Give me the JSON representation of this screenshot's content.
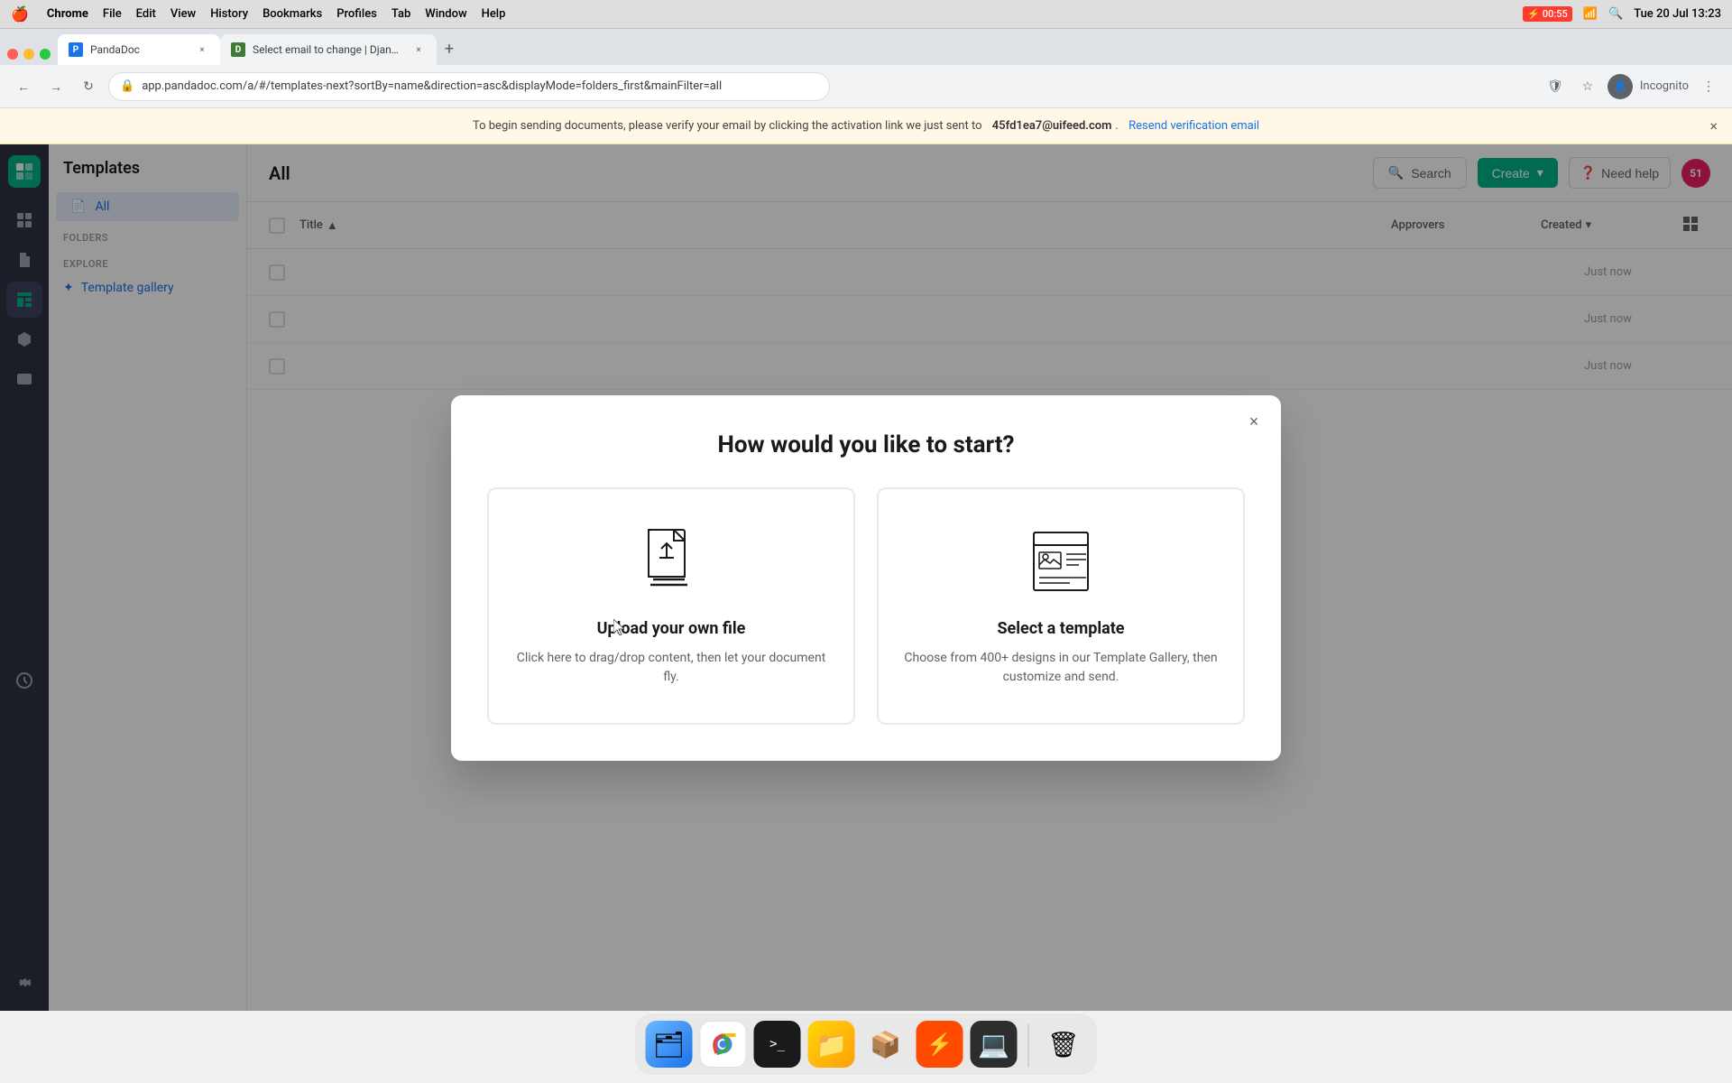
{
  "menubar": {
    "apple": "🍎",
    "app_name": "Chrome",
    "items": [
      "File",
      "Edit",
      "View",
      "History",
      "Bookmarks",
      "Profiles",
      "Tab",
      "Window",
      "Help"
    ],
    "battery_label": "00:55",
    "time": "Tue 20 Jul  13:23"
  },
  "browser": {
    "tab1_title": "PandaDoc",
    "tab2_title": "Select email to change | Djang...",
    "url": "app.pandadoc.com/a/#/templates-next?sortBy=name&direction=asc&displayMode=folders_first&mainFilter=all"
  },
  "notification": {
    "text": "To begin sending documents, please verify your email by clicking the activation link we just sent to",
    "email": "45fd1ea7@uifeed.com",
    "link_text": "Resend verification email"
  },
  "sidebar": {
    "items": [
      {
        "icon": "grid",
        "label": "Dashboard"
      },
      {
        "icon": "file",
        "label": "Documents"
      },
      {
        "icon": "list",
        "label": "Templates",
        "active": true
      },
      {
        "icon": "tag",
        "label": "Catalog"
      },
      {
        "icon": "image",
        "label": "Media"
      },
      {
        "icon": "clock",
        "label": "History"
      }
    ],
    "bottom_items": [
      {
        "icon": "settings",
        "label": "Settings"
      }
    ]
  },
  "nav": {
    "title": "Templates",
    "items": [
      {
        "label": "All",
        "active": true,
        "icon": "📄"
      }
    ],
    "sections": {
      "folders": "FOLDERS",
      "explore": "EXPLORE"
    },
    "explore_item": {
      "label": "Template gallery",
      "icon": "✦"
    }
  },
  "main": {
    "title": "All",
    "search_label": "Search",
    "create_label": "Create",
    "help_label": "Need help",
    "table": {
      "col_title": "Title",
      "col_approvers": "Approvers",
      "col_created": "Created",
      "rows": [
        {
          "title": "",
          "time": "Just now"
        },
        {
          "title": "",
          "time": "Just now"
        },
        {
          "title": "",
          "time": "Just now"
        }
      ]
    }
  },
  "modal": {
    "title": "How would you like to start?",
    "close_label": "×",
    "option1": {
      "title": "Upload your own file",
      "description": "Click here to drag/drop content, then let your document fly."
    },
    "option2": {
      "title": "Select a template",
      "description": "Choose from 400+ designs in our Template Gallery, then customize and send."
    }
  },
  "dock": {
    "items": [
      {
        "name": "finder",
        "emoji": "🗂"
      },
      {
        "name": "chrome",
        "emoji": "🌐"
      },
      {
        "name": "terminal",
        "label": ">_"
      },
      {
        "name": "files",
        "emoji": "📁"
      },
      {
        "name": "apps",
        "emoji": "📦"
      },
      {
        "name": "zapier",
        "emoji": "⚡"
      },
      {
        "name": "terminal2",
        "emoji": "💻"
      },
      {
        "name": "trash",
        "emoji": "🗑"
      }
    ]
  },
  "colors": {
    "accent": "#00b386",
    "brand": "#2d3142",
    "link": "#1a73e8",
    "danger": "#ff3b30"
  }
}
